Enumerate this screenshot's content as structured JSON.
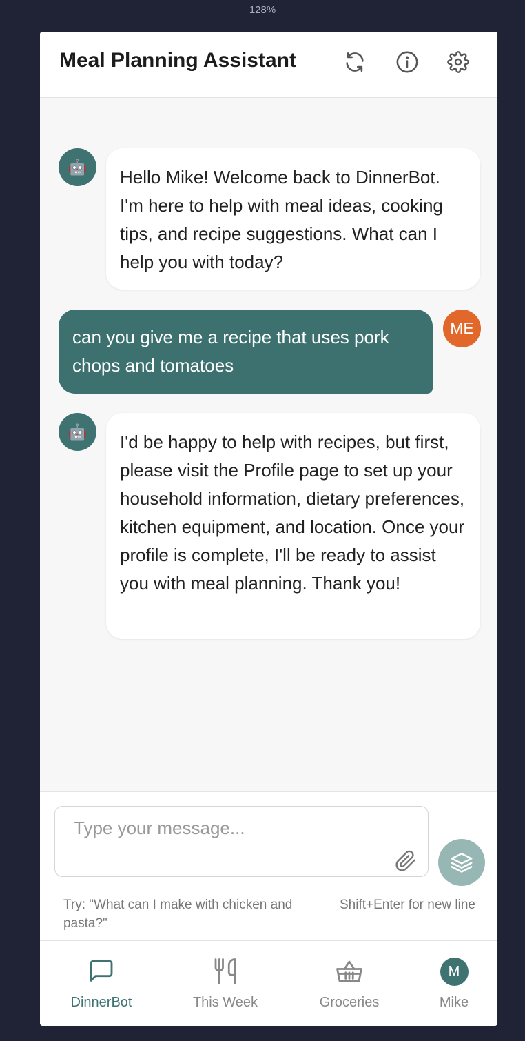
{
  "zoom": "128%",
  "header": {
    "title": "Meal Planning Assistant",
    "icons": [
      "refresh-icon",
      "info-icon",
      "settings-icon"
    ]
  },
  "messages": [
    {
      "role": "bot",
      "avatar": "🤖",
      "text": "Hello Mike! Welcome back to DinnerBot. I'm here to help with meal ideas, cooking tips, and recipe suggestions. What can I help you with today?"
    },
    {
      "role": "user",
      "avatar": "ME",
      "text": "can you give me a recipe that uses pork chops and tomatoes"
    },
    {
      "role": "bot",
      "avatar": "🤖",
      "text": "I'd be happy to help with recipes, but first, please visit the Profile page to set up your household information, dietary preferences, kitchen equipment, and location. Once your profile is complete, I'll be ready to assist you with meal planning. Thank you!"
    }
  ],
  "composer": {
    "placeholder": "Type your message...",
    "hint_left": "Try: \"What can I make with chicken and pasta?\"",
    "hint_right": "Shift+Enter for new line"
  },
  "nav": [
    {
      "label": "DinnerBot",
      "icon": "chat-icon",
      "active": true
    },
    {
      "label": "This Week",
      "icon": "fork-knife-icon",
      "active": false
    },
    {
      "label": "Groceries",
      "icon": "basket-icon",
      "active": false
    },
    {
      "label": "Mike",
      "icon": "avatar",
      "avatar_letter": "M",
      "active": false
    }
  ],
  "colors": {
    "accent": "#3e7371",
    "user_avatar": "#e2672a",
    "send_button": "#97b7b4",
    "background": "#1f2335"
  }
}
